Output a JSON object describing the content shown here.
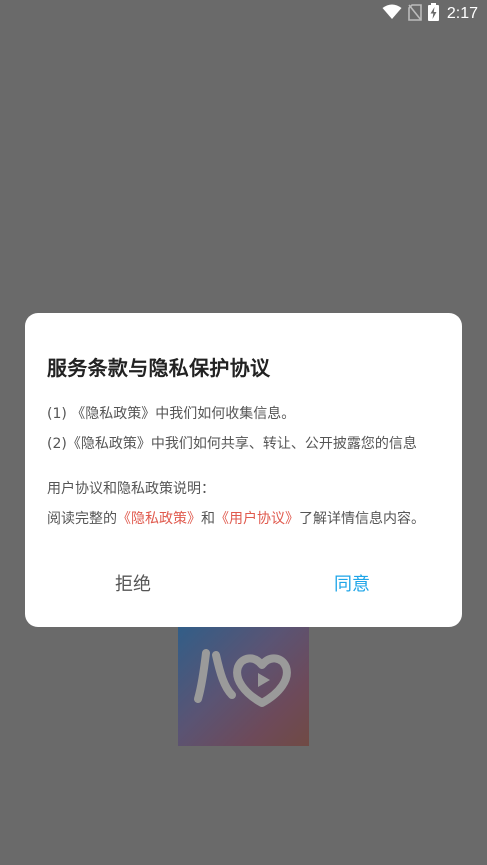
{
  "status_bar": {
    "time": "2:17",
    "icons": [
      "wifi-icon",
      "no-sim-icon",
      "battery-charging-icon"
    ]
  },
  "dialog": {
    "title": "服务条款与隐私保护协议",
    "line1": "(1) 《隐私政策》中我们如何收集信息。",
    "line2": "(2)《隐私政策》中我们如何共享、转让、公开披露您的信息",
    "line3": "用户协议和隐私政策说明：",
    "line4": {
      "prefix": "阅读完整的",
      "privacy_link": "《隐私政策》",
      "conjunction": "和",
      "user_agreement_link": "《用户协议》",
      "suffix": "了解详情信息内容。"
    },
    "reject_label": "拒绝",
    "agree_label": "同意"
  },
  "colors": {
    "overlay": "#6a6a6a",
    "link_red": "#e05a4e",
    "agree_blue": "#1ea5e8",
    "title": "#222222",
    "body_text": "#555555"
  },
  "splash": {
    "logo_icon": "heart-logo-icon"
  }
}
